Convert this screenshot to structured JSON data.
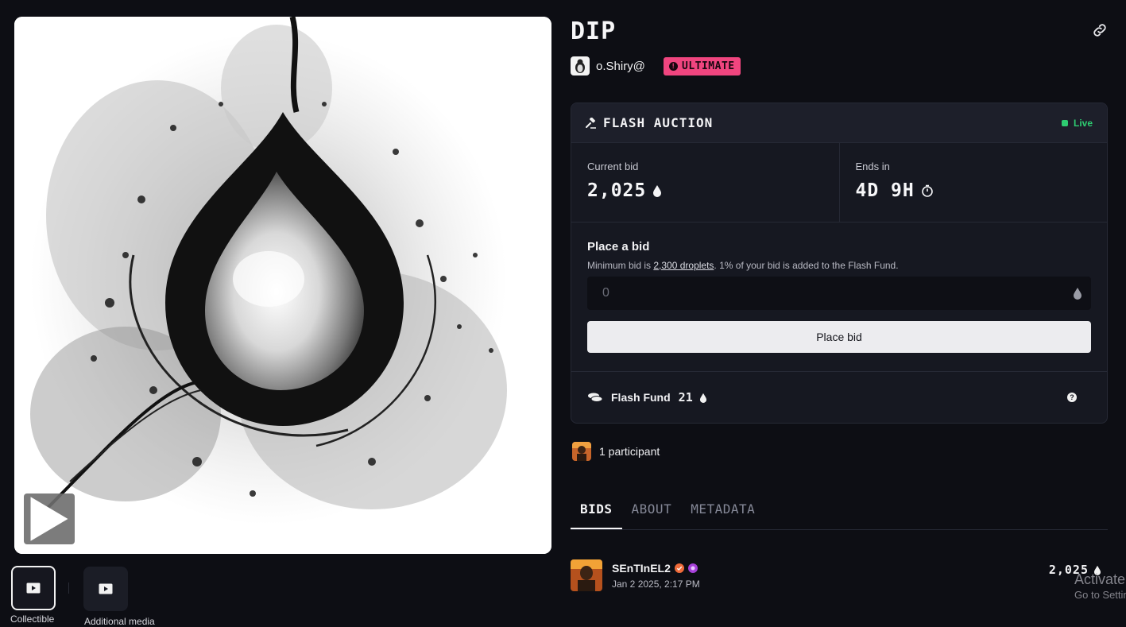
{
  "artwork": {
    "play_icon": "play-icon"
  },
  "media": {
    "items": [
      {
        "label": "Collectible",
        "icon": "video-icon"
      },
      {
        "label": "Additional media",
        "icon": "video-icon"
      }
    ]
  },
  "header": {
    "title": "DIP",
    "link_icon": "link-icon",
    "creator_name": "o.Shiry@",
    "tier_badge": "ULTIMATE",
    "tier_badge_symbol": "!"
  },
  "auction": {
    "type_label": "FLASH AUCTION",
    "status": "Live",
    "current_bid_label": "Current bid",
    "current_bid_value": "2,025",
    "ends_in_label": "Ends in",
    "ends_in_value": "4D 9H",
    "place_bid_heading": "Place a bid",
    "min_bid_prefix": "Minimum bid is ",
    "min_bid_link": "2,300 droplets",
    "min_bid_suffix": ". 1% of your bid is added to the Flash Fund.",
    "bid_input_placeholder": "0",
    "place_bid_button": "Place bid",
    "flash_fund_label": "Flash Fund",
    "flash_fund_value": "21",
    "help_symbol": "?"
  },
  "participants": {
    "text": "1 participant"
  },
  "tabs": [
    {
      "label": "BIDS",
      "active": true
    },
    {
      "label": "ABOUT",
      "active": false
    },
    {
      "label": "METADATA",
      "active": false
    }
  ],
  "bids": [
    {
      "user": "SEnTInEL2",
      "date": "Jan 2 2025, 2:17 PM",
      "amount": "2,025"
    }
  ],
  "watermark": {
    "line1": "Activate Windows",
    "line2": "Go to Settings to activate Windows."
  },
  "colors": {
    "background": "#0d0e14",
    "badge": "#f0457f",
    "live": "#2ecc71"
  }
}
